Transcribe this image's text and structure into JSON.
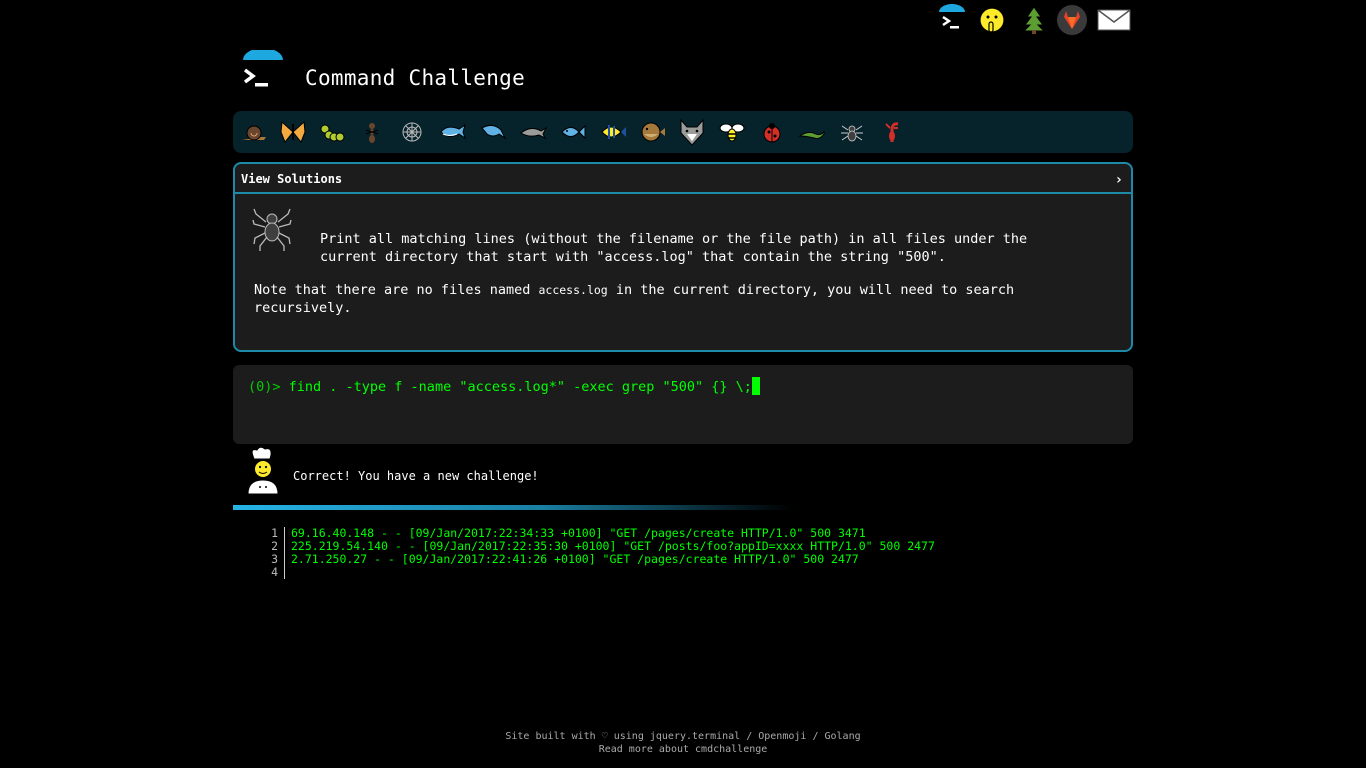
{
  "app": {
    "title": "Command Challenge"
  },
  "top_nav": {
    "items": [
      {
        "icon": "terminal-icon"
      },
      {
        "icon": "shushing-face-icon"
      },
      {
        "icon": "tree-icon"
      },
      {
        "icon": "gitlab-icon"
      },
      {
        "icon": "envelope-icon"
      }
    ]
  },
  "animals": [
    "snail",
    "butterfly",
    "caterpillar",
    "ant",
    "spider-web",
    "whale",
    "dolphin",
    "dolphin-gray",
    "fish",
    "tropical-fish",
    "blowfish",
    "wolf",
    "bee",
    "ladybug",
    "lizard",
    "spider",
    "scorpion"
  ],
  "challenge": {
    "header": "View Solutions",
    "chevron": "›",
    "description": "Print all matching lines (without the filename or the file path) in all files under the current directory that start with \"access.log\" that contain the string \"500\".",
    "note_before": "Note that there are no files named ",
    "note_code": "access.log",
    "note_after": " in the current directory, you will need to search recursively."
  },
  "terminal": {
    "prompt": "(0)> ",
    "command": "find . -type f -name \"access.log*\" -exec grep \"500\" {} \\;"
  },
  "feedback": {
    "message": "Correct! You have a new challenge!"
  },
  "output": {
    "lines": [
      {
        "num": "1",
        "text": "69.16.40.148 - - [09/Jan/2017:22:34:33 +0100] \"GET /pages/create HTTP/1.0\" 500 3471"
      },
      {
        "num": "2",
        "text": "225.219.54.140 - - [09/Jan/2017:22:35:30 +0100] \"GET /posts/foo?appID=xxxx HTTP/1.0\" 500 2477"
      },
      {
        "num": "3",
        "text": "2.71.250.27 - - [09/Jan/2017:22:41:26 +0100] \"GET /pages/create HTTP/1.0\" 500 2477"
      },
      {
        "num": "4",
        "text": ""
      }
    ]
  },
  "footer": {
    "line1_prefix": "Site built with ♡ using ",
    "jquery_terminal": "jquery.terminal",
    "sep1": " / ",
    "openmoji": "Openmoji",
    "sep2": " / ",
    "golang": "Golang",
    "read_more": "Read more about cmdchallenge"
  },
  "colors": {
    "accent": "#1e8aa8",
    "terminal_green": "#00ff00",
    "panel_bg": "#1c1c1c",
    "animal_bar_bg": "#06222b"
  }
}
